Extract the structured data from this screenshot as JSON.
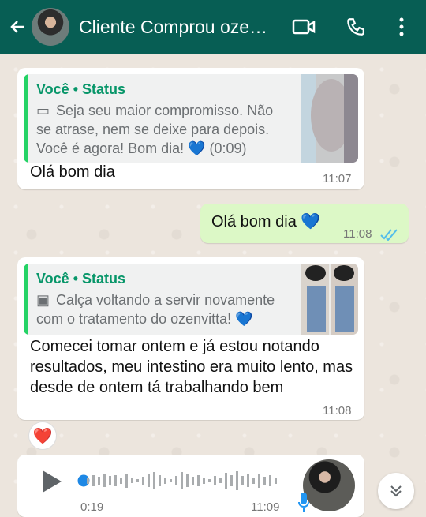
{
  "header": {
    "title": "Cliente Comprou oze…"
  },
  "messages": [
    {
      "quote_name": "Você • Status",
      "quote_text": "Seja seu maior compromisso. Não se atrase, nem se deixe para depois. Você é agora! Bom dia! 💙 (0:09)",
      "text": "Olá bom dia",
      "time": "11:07"
    },
    {
      "text": "Olá bom dia 💙",
      "time": "11:08"
    },
    {
      "quote_name": "Você • Status",
      "quote_text": "Calça voltando a servir novamente com o tratamento do ozenvitta! 💙",
      "text": "Comecei tomar ontem e já estou notando resultados, meu intestino era muito lento, mas desde de ontem tá trabalhando bem",
      "time": "11:08",
      "reaction": "❤️"
    },
    {
      "duration": "0:19",
      "time": "11:09"
    }
  ],
  "colors": {
    "header": "#075e54",
    "sent_bubble": "#dcf8c6",
    "status_green": "#079669",
    "read_receipt": "#53bdeb"
  },
  "icons": {
    "back": "arrow-left-icon",
    "video": "video-call-icon",
    "phone": "phone-icon",
    "menu": "more-vertical-icon"
  }
}
